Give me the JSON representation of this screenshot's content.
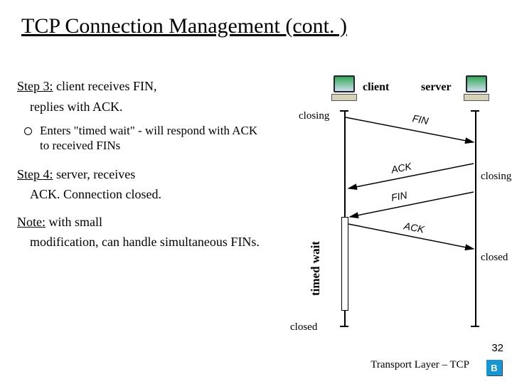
{
  "title": "TCP Connection Management (cont. )",
  "text": {
    "step3_label": "Step 3:",
    "step3_lead": " client receives FIN,",
    "step3_cont": "replies with ACK.",
    "bullet": "Enters \"timed wait\" - will respond with ACK to received FINs",
    "step4_label": "Step 4:",
    "step4_lead": " server, receives",
    "step4_cont": "ACK.  Connection closed.",
    "note_label": "Note:",
    "note_lead": " with small",
    "note_cont": "modification, can handle simultaneous FINs."
  },
  "diagram": {
    "client": "client",
    "server": "server",
    "closing": "closing",
    "closing2": "closing",
    "timed_wait": "timed wait",
    "closed_left": "closed",
    "closed_right": "closed",
    "msg_fin1": "FIN",
    "msg_ack1": "ACK",
    "msg_fin2": "FIN",
    "msg_ack2": "ACK"
  },
  "footer": {
    "page": "32",
    "label": "Transport Layer – TCP",
    "badge": "B"
  }
}
